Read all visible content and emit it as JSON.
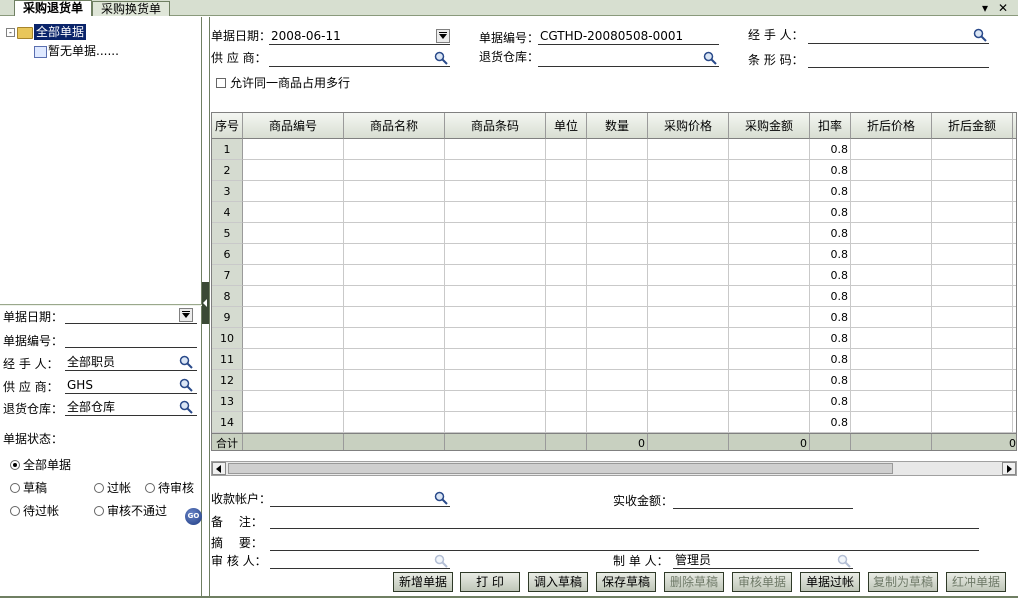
{
  "tabs": [
    {
      "label": "采购退货单",
      "active": true
    },
    {
      "label": "采购换货单",
      "active": false
    }
  ],
  "window_controls": {
    "pin": "▾",
    "close": "✕"
  },
  "tree": {
    "root": "全部单据",
    "expand_glyph": "-",
    "children": [
      "暂无单据......"
    ]
  },
  "filters": {
    "date_label": "单据日期：",
    "date_value": "",
    "number_label": "单据编号：",
    "number_value": "",
    "handler_label": "经 手 人：",
    "handler_value": "全部职员",
    "supplier_label": "供 应 商：",
    "supplier_value": "GHS",
    "warehouse_label": "退货仓库：",
    "warehouse_value": "全部仓库",
    "status_label": "单据状态：",
    "status_options": [
      "全部单据",
      "草稿",
      "过帐",
      "待审核",
      "待过帐",
      "审核不通过"
    ],
    "status_selected": 0,
    "go_label": "GO"
  },
  "header": {
    "date_label": "单据日期：",
    "date_value": "2008-06-11",
    "number_label": "单据编号：",
    "number_value": "CGTHD-20080508-0001",
    "handler_label": "经 手 人：",
    "handler_value": "",
    "supplier_label": "供 应 商：",
    "supplier_value": "",
    "warehouse_label": "退货仓库：",
    "warehouse_value": "",
    "barcode_label": "条 形 码：",
    "barcode_value": "",
    "allow_multi_label": "允许同一商品占用多行"
  },
  "grid": {
    "columns": [
      "序号",
      "商品编号",
      "商品名称",
      "商品条码",
      "单位",
      "数量",
      "采购价格",
      "采购金额",
      "扣率",
      "折后价格",
      "折后金额"
    ],
    "rows": [
      {
        "no": "1",
        "rate": "0.8"
      },
      {
        "no": "2",
        "rate": "0.8"
      },
      {
        "no": "3",
        "rate": "0.8"
      },
      {
        "no": "4",
        "rate": "0.8"
      },
      {
        "no": "5",
        "rate": "0.8"
      },
      {
        "no": "6",
        "rate": "0.8"
      },
      {
        "no": "7",
        "rate": "0.8"
      },
      {
        "no": "8",
        "rate": "0.8"
      },
      {
        "no": "9",
        "rate": "0.8"
      },
      {
        "no": "10",
        "rate": "0.8"
      },
      {
        "no": "11",
        "rate": "0.8"
      },
      {
        "no": "12",
        "rate": "0.8"
      },
      {
        "no": "13",
        "rate": "0.8"
      },
      {
        "no": "14",
        "rate": "0.8"
      }
    ],
    "total_label": "合计",
    "total_qty": "0",
    "total_amount": "0",
    "total_after": "0"
  },
  "footer": {
    "account_label": "收款帐户：",
    "account_value": "",
    "received_label": "实收金额：",
    "received_value": "",
    "remark_label": "备　 注：",
    "remark_value": "",
    "summary_label": "摘　 要：",
    "summary_value": "",
    "auditor_label": "审 核 人：",
    "auditor_value": "",
    "maker_label": "制 单 人：",
    "maker_value": "管理员"
  },
  "buttons": [
    {
      "label": "新增单据",
      "enabled": true
    },
    {
      "label": "打  印",
      "enabled": true
    },
    {
      "label": "调入草稿",
      "enabled": true
    },
    {
      "label": "保存草稿",
      "enabled": true
    },
    {
      "label": "删除草稿",
      "enabled": false
    },
    {
      "label": "审核单据",
      "enabled": false
    },
    {
      "label": "单据过帐",
      "enabled": true
    },
    {
      "label": "复制为草稿",
      "enabled": false
    },
    {
      "label": "红冲单据",
      "enabled": false
    }
  ],
  "colors": {
    "frame": "#6f7f62",
    "header_bg": "#d8ded2",
    "total_bg": "#c8d0c0",
    "selection": "#0a246a"
  }
}
